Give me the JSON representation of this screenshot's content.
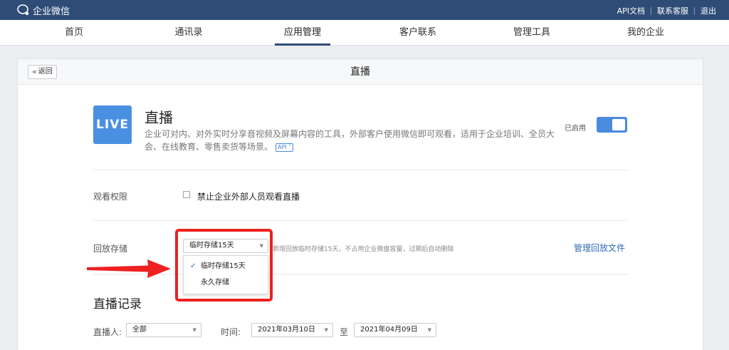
{
  "topbar": {
    "logo_text": "企业微信",
    "links": [
      "API文档",
      "联系客服",
      "退出"
    ]
  },
  "nav": {
    "items": [
      "首页",
      "通讯录",
      "应用管理",
      "客户联系",
      "管理工具",
      "我的企业"
    ],
    "active": "应用管理"
  },
  "panel": {
    "back_label": "返回",
    "title": "直播"
  },
  "app": {
    "logo_text": "LIVE",
    "name": "直播",
    "description": "企业可对内、对外实时分享音视频及屏幕内容的工具，外部客户使用微信即可观看，适用于企业培训、全员大会、在线教育、零售卖货等场景。",
    "api_badge": "API",
    "status_label": "已启用",
    "enabled": true
  },
  "permission": {
    "label": "观看权限",
    "checkbox_label": "禁止企业外部人员观看直播",
    "checked": false
  },
  "storage": {
    "label": "回放存储",
    "selected": "临时存储15天",
    "hint": "新增回放临时存储15天，不占用企业微盘容量，过期后自动删除",
    "manage_link": "管理回放文件",
    "options": [
      "临时存储15天",
      "永久存储"
    ]
  },
  "records": {
    "title": "直播记录",
    "host_label": "直播人:",
    "host_value": "全部",
    "time_label": "时间:",
    "start_date": "2021年03月10日",
    "to_label": "至",
    "end_date": "2021年04月09日"
  },
  "colors": {
    "topbar": "#2f4c77",
    "accent": "#4a90e2",
    "highlight": "#ee2020"
  }
}
